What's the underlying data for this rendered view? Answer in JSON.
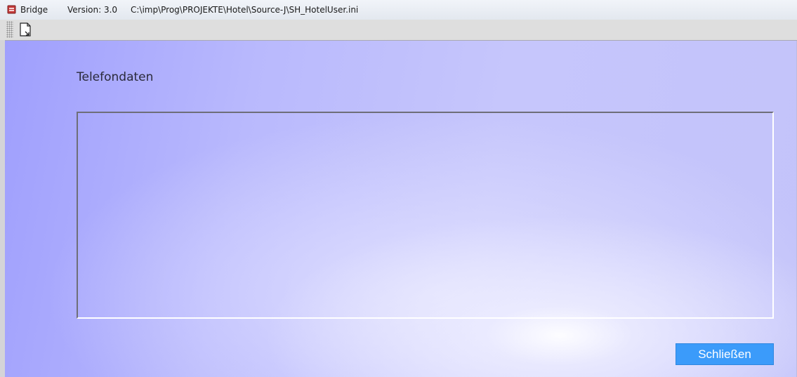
{
  "window": {
    "app_name": "Bridge",
    "version": "Version: 3.0",
    "file_path": "C:\\imp\\Prog\\PROJEKTE\\Hotel\\Source-J\\SH_HotelUser.ini"
  },
  "toolbar": {
    "buttons": [
      {
        "icon": "document-icon"
      }
    ]
  },
  "main": {
    "title": "Telefondaten",
    "close_label": "Schließen"
  },
  "colors": {
    "button_blue": "#3b9bfa",
    "background_purple": "#a9a9fd"
  }
}
